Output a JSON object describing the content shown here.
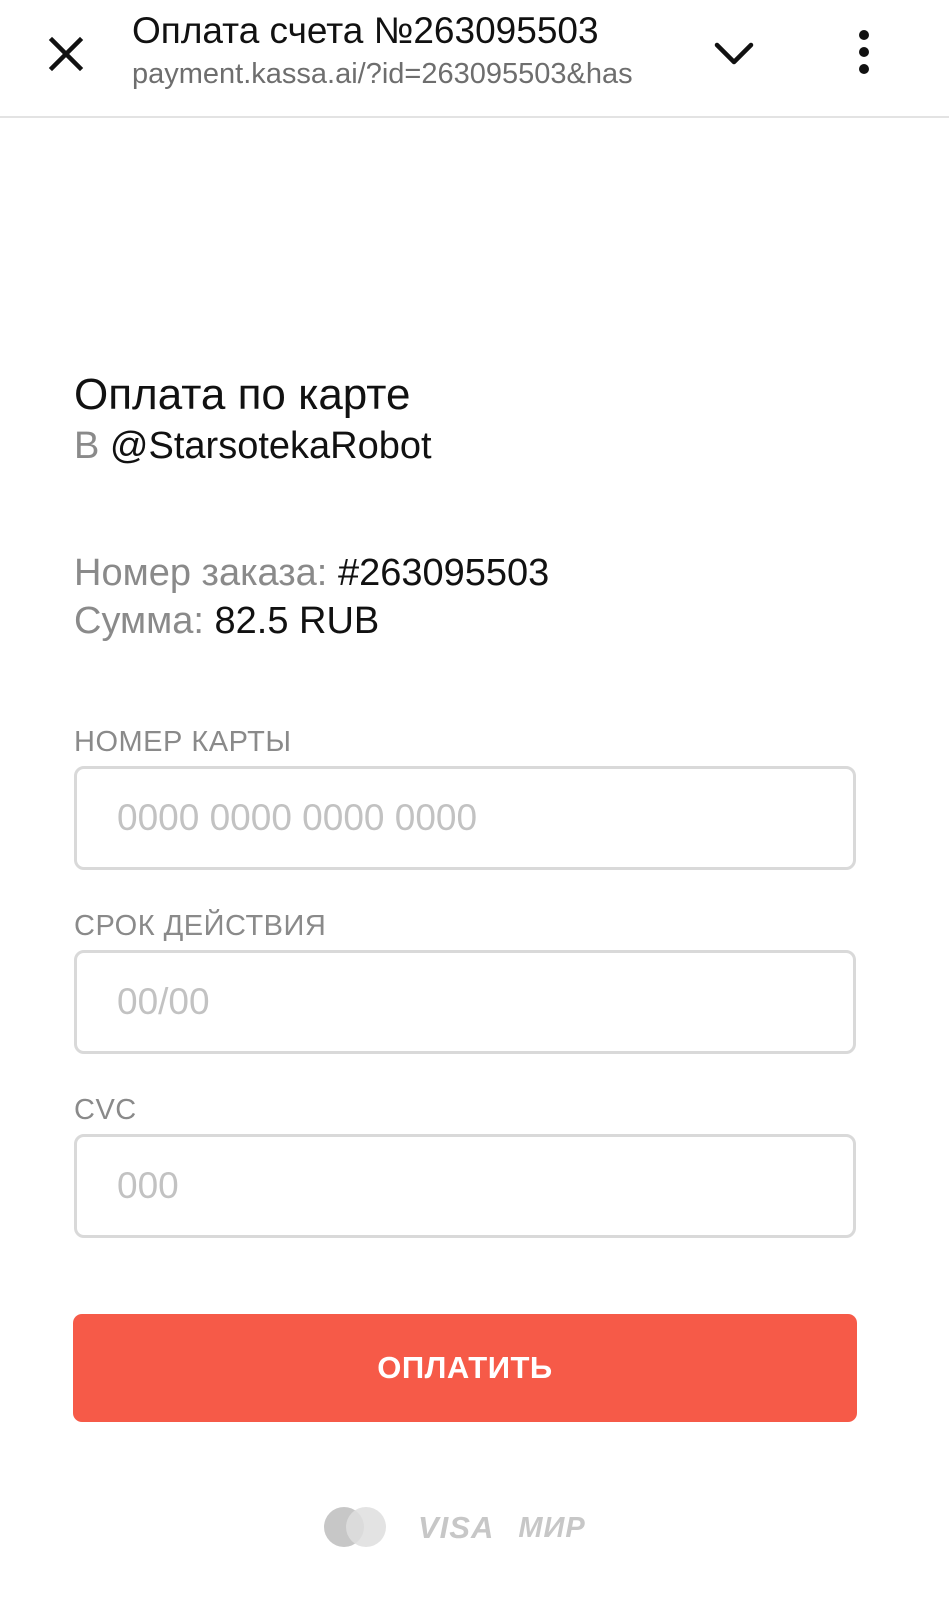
{
  "browser": {
    "title": "Оплата счета №263095503",
    "url": "payment.kassa.ai/?id=263095503&has"
  },
  "payment": {
    "heading": "Оплата по карте",
    "recipient_prefix": "В",
    "recipient_name": "@StarsotekaRobot",
    "order_label": "Номер заказа:",
    "order_value": "#263095503",
    "sum_label": "Сумма:",
    "sum_value": "82.5 RUB"
  },
  "form": {
    "card_number_label": "НОМЕР КАРТЫ",
    "card_number_placeholder": "0000 0000 0000 0000",
    "expiry_label": "СРОК ДЕЙСТВИЯ",
    "expiry_placeholder": "00/00",
    "cvc_label": "CVC",
    "cvc_placeholder": "000",
    "submit_label": "ОПЛАТИТЬ"
  },
  "payment_systems": {
    "mastercard_icon": "mastercard-logo-icon",
    "visa": "VISA",
    "mir": "МИР"
  },
  "colors": {
    "accent": "#f65a48",
    "muted_text": "#8a8a8a",
    "placeholder": "#c2c2c2",
    "border": "#d9d9d9"
  }
}
